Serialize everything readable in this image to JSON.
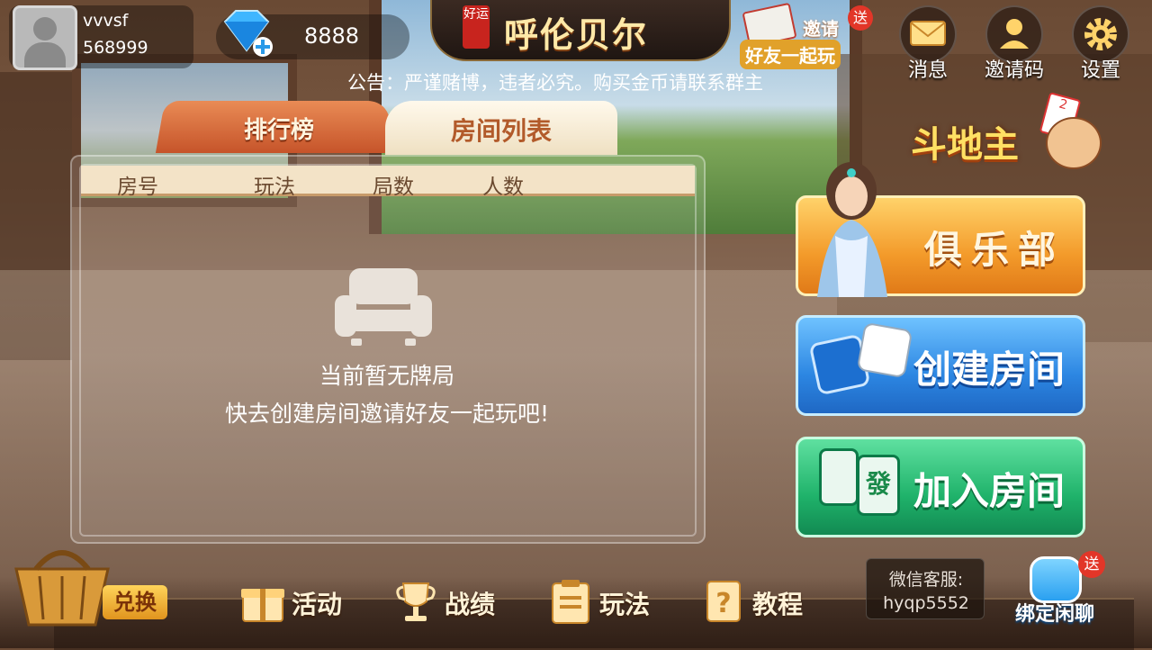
{
  "user": {
    "name": "vvvsf",
    "id": "568999"
  },
  "currency": {
    "amount": "8888"
  },
  "title": {
    "badge": "好运",
    "name": "呼伦贝尔"
  },
  "invite_banner": {
    "line1": "邀请",
    "line2": "好友一起玩",
    "badge": "送"
  },
  "top_buttons": [
    {
      "label": "消息",
      "icon": "mail-icon"
    },
    {
      "label": "邀请码",
      "icon": "user-icon"
    },
    {
      "label": "设置",
      "icon": "gear-icon"
    }
  ],
  "notice": "公告：严谨赌博，违者必究。购买金币请联系群主",
  "tabs": {
    "rank": "排行榜",
    "rooms": "房间列表"
  },
  "table": {
    "headers": [
      "房号",
      "玩法",
      "局数",
      "人数"
    ]
  },
  "empty": {
    "line1": "当前暂无牌局",
    "line2": "快去创建房间邀请好友一起玩吧!"
  },
  "game": {
    "name": "斗地主"
  },
  "actions": {
    "club": "俱乐部",
    "create": "创建房间",
    "join": "加入房间"
  },
  "tile_glyph": "發",
  "bottom": {
    "exchange": "兑换",
    "nav": [
      {
        "label": "活动",
        "icon": "gift-icon"
      },
      {
        "label": "战绩",
        "icon": "trophy-icon"
      },
      {
        "label": "玩法",
        "icon": "clipboard-icon"
      },
      {
        "label": "教程",
        "icon": "help-book-icon"
      }
    ],
    "wechat_label": "微信客服:",
    "wechat_id": "hyqp5552",
    "bind": {
      "label": "绑定闲聊",
      "badge": "送"
    }
  },
  "colors": {
    "accent_orange": "#f39a2a",
    "accent_blue": "#2c86e2",
    "accent_green": "#1fb26a",
    "tab_red": "#c6542a"
  }
}
